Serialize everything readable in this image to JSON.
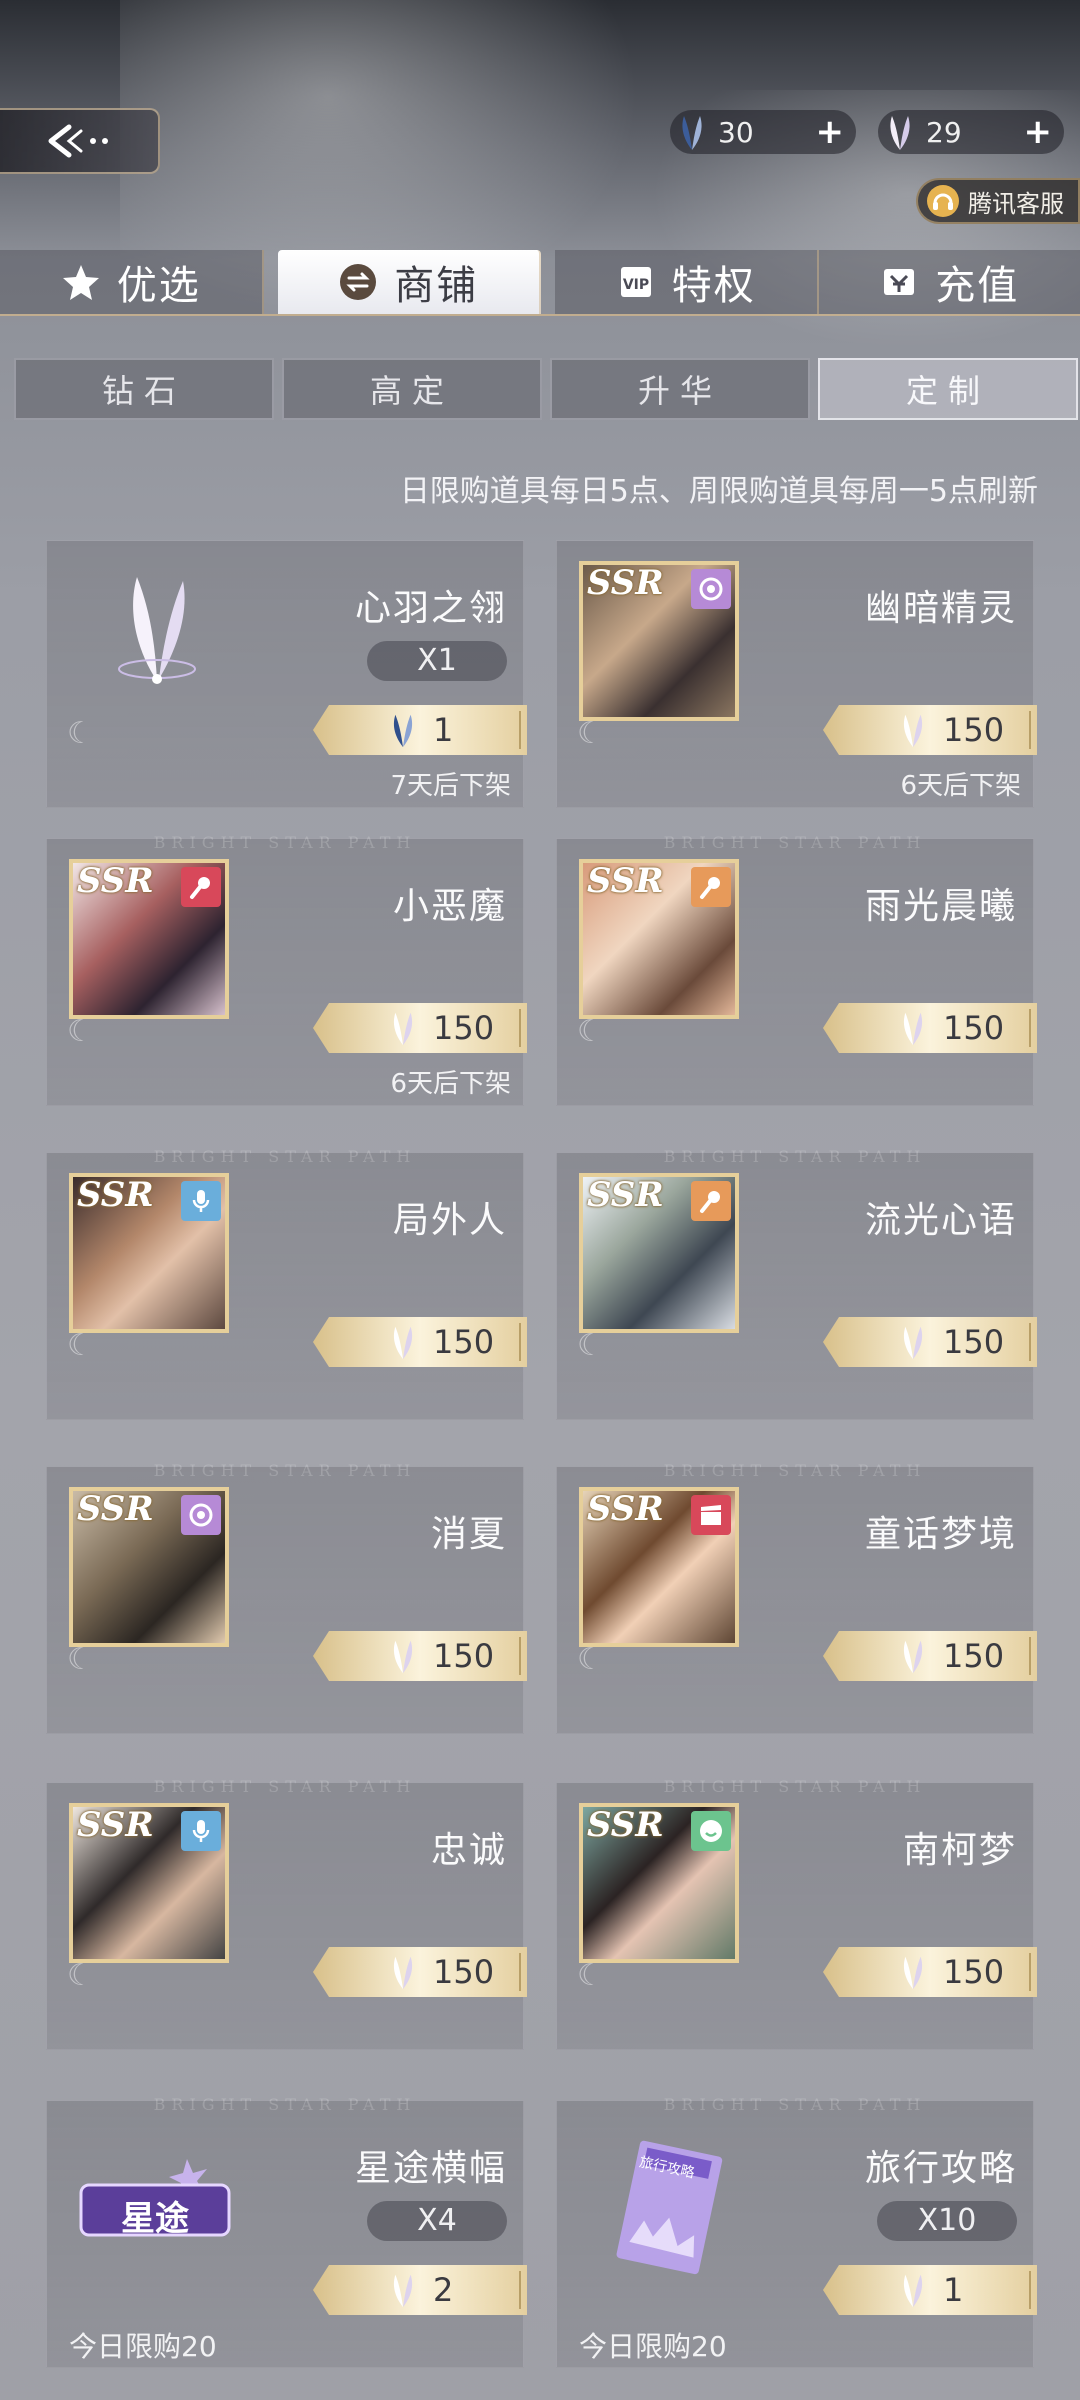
{
  "currencies": [
    {
      "icon": "blue-feather-icon",
      "value": "30"
    },
    {
      "icon": "white-feather-icon",
      "value": "29"
    }
  ],
  "customer_service": {
    "label": "腾讯客服"
  },
  "main_tabs": [
    {
      "label": "优选",
      "icon": "star-icon"
    },
    {
      "label": "商铺",
      "icon": "exchange-icon"
    },
    {
      "label": "特权",
      "icon": "vip-card-icon"
    },
    {
      "label": "充值",
      "icon": "recharge-icon"
    }
  ],
  "active_main_tab": "商铺",
  "sub_tabs": [
    {
      "label": "钻石"
    },
    {
      "label": "高定"
    },
    {
      "label": "升华"
    },
    {
      "label": "定制"
    }
  ],
  "active_sub_tab": "定制",
  "notice": "日限购道具每日5点、周限购道具每周一5点刷新",
  "watermark": "BRIGHT STAR PATH",
  "items": [
    {
      "name": "心羽之翎",
      "quantity": "X1",
      "price": "1",
      "currency": "blue-feather-icon",
      "timer": "7天后下架",
      "kind": "item"
    },
    {
      "name": "幽暗精灵",
      "rarity": "SSR",
      "type": "circle-record-icon",
      "price": "150",
      "currency": "white-feather-icon",
      "timer": "6天后下架",
      "kind": "card"
    },
    {
      "name": "小恶魔",
      "rarity": "SSR",
      "type": "microphone-icon",
      "price": "150",
      "currency": "white-feather-icon",
      "timer": "6天后下架",
      "kind": "card"
    },
    {
      "name": "雨光晨曦",
      "rarity": "SSR",
      "type": "microphone-icon",
      "price": "150",
      "currency": "white-feather-icon",
      "kind": "card"
    },
    {
      "name": "局外人",
      "rarity": "SSR",
      "type": "podcast-mic-icon",
      "price": "150",
      "currency": "white-feather-icon",
      "kind": "card"
    },
    {
      "name": "流光心语",
      "rarity": "SSR",
      "type": "microphone-icon",
      "price": "150",
      "currency": "white-feather-icon",
      "kind": "card"
    },
    {
      "name": "消夏",
      "rarity": "SSR",
      "type": "circle-record-icon",
      "price": "150",
      "currency": "white-feather-icon",
      "kind": "card"
    },
    {
      "name": "童话梦境",
      "rarity": "SSR",
      "type": "clapperboard-icon",
      "price": "150",
      "currency": "white-feather-icon",
      "kind": "card"
    },
    {
      "name": "忠诚",
      "rarity": "SSR",
      "type": "podcast-mic-icon",
      "price": "150",
      "currency": "white-feather-icon",
      "kind": "card"
    },
    {
      "name": "南柯梦",
      "rarity": "SSR",
      "type": "smile-icon",
      "price": "150",
      "currency": "white-feather-icon",
      "kind": "card"
    },
    {
      "name": "星途横幅",
      "quantity": "X4",
      "price": "2",
      "currency": "white-feather-icon",
      "limit": "今日限购20",
      "banner_text": "星途",
      "kind": "item"
    },
    {
      "name": "旅行攻略",
      "quantity": "X10",
      "price": "1",
      "currency": "white-feather-icon",
      "limit": "今日限购20",
      "book_text": "旅行攻略",
      "kind": "item"
    }
  ],
  "colors": {
    "gold_accent": "#e6cf9a",
    "type_purple": "#b68ad6",
    "type_orange": "#e79a5a",
    "type_blue": "#6aaedb",
    "type_red": "#d8485a",
    "type_green": "#6cc48e"
  }
}
